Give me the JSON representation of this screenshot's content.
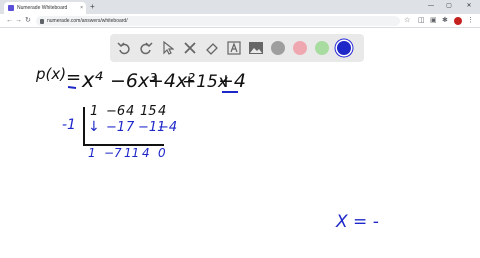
{
  "browser": {
    "tab_title": "Numerade Whiteboard",
    "tab_close": "×",
    "new_tab": "+",
    "url": "numerade.com/answers/whiteboard/",
    "win_min": "—",
    "win_max": "▢",
    "win_close": "✕"
  },
  "toolbar": {
    "tools": [
      "undo-icon",
      "redo-icon",
      "select-icon",
      "tools-icon",
      "eraser-icon",
      "text-icon",
      "image-icon"
    ],
    "swatches": [
      {
        "name": "gray",
        "color": "#9e9e9e"
      },
      {
        "name": "pink",
        "color": "#f0a8b0"
      },
      {
        "name": "green",
        "color": "#a8dca0"
      },
      {
        "name": "blue",
        "color": "#1e28c8"
      }
    ]
  },
  "board": {
    "px_label": "p(x)",
    "equals": "=",
    "polynomial_terms": [
      "x⁴",
      "−6x³",
      "+4x²",
      "+15x",
      "+4"
    ],
    "divisor": "-1",
    "coefficients": [
      "1",
      "−6",
      "4",
      "15",
      "4"
    ],
    "multiply_row": [
      "↓",
      "−1",
      "7",
      "−11",
      "−4"
    ],
    "result_row": [
      "1",
      "−7",
      "11",
      "4",
      "0"
    ],
    "x_equals": "X = -"
  }
}
